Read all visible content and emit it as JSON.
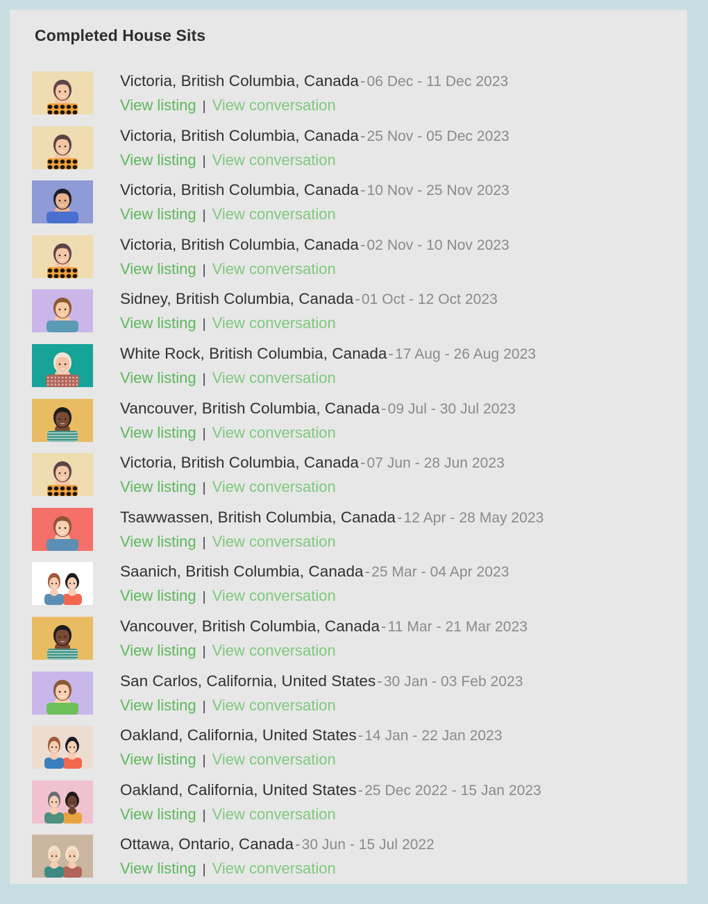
{
  "page": {
    "title": "Completed House Sits",
    "panel_bg": "#e7e7e7",
    "outer_bg": "#c8dde2",
    "link_listing_color": "#5cb85c",
    "link_conversation_color": "#7ec97e",
    "date_color": "#8a8a8a"
  },
  "labels": {
    "view_listing": "View listing",
    "view_conversation": "View conversation",
    "separator": "|",
    "dash": "-"
  },
  "sits": [
    {
      "location": "Victoria, British Columbia, Canada",
      "dates": "06 Dec - 11 Dec 2023",
      "avatar": {
        "name": "avatar-woman-leopard-top",
        "bg": "#efdcb0",
        "type": "single",
        "hair": "#5a4449",
        "skin": "#f5c6a5",
        "shirt": "#f0a23c",
        "pattern": "spots"
      }
    },
    {
      "location": "Victoria, British Columbia, Canada",
      "dates": "25 Nov - 05 Dec 2023",
      "avatar": {
        "name": "avatar-woman-leopard-top",
        "bg": "#efdcb0",
        "type": "single",
        "hair": "#5a4449",
        "skin": "#f5c6a5",
        "shirt": "#f0a23c",
        "pattern": "spots"
      }
    },
    {
      "location": "Victoria, British Columbia, Canada",
      "dates": "10 Nov - 25 Nov 2023",
      "avatar": {
        "name": "avatar-woman-dark-hair-blue",
        "bg": "#8e9bd6",
        "type": "single",
        "hair": "#1d1d28",
        "skin": "#e8b48e",
        "shirt": "#4a6fd0",
        "pattern": "plain"
      }
    },
    {
      "location": "Victoria, British Columbia, Canada",
      "dates": "02 Nov - 10 Nov 2023",
      "avatar": {
        "name": "avatar-woman-leopard-top",
        "bg": "#efdcb0",
        "type": "single",
        "hair": "#5a4449",
        "skin": "#f5c6a5",
        "shirt": "#f0a23c",
        "pattern": "spots"
      }
    },
    {
      "location": "Sidney, British Columbia, Canada",
      "dates": "01 Oct - 12 Oct 2023",
      "avatar": {
        "name": "avatar-man-brown-hair-purple",
        "bg": "#cbb6ea",
        "type": "single",
        "hair": "#8a5a33",
        "skin": "#f6c9a6",
        "shirt": "#5b9bb5",
        "pattern": "plain"
      }
    },
    {
      "location": "White Rock, British Columbia, Canada",
      "dates": "17 Aug - 26 Aug 2023",
      "avatar": {
        "name": "avatar-woman-white-hair-teal",
        "bg": "#17a398",
        "type": "single",
        "hair": "#f0e4d4",
        "skin": "#f3c4a7",
        "shirt": "#b0645a",
        "pattern": "knit"
      }
    },
    {
      "location": "Vancouver, British Columbia, Canada",
      "dates": "09 Jul - 30 Jul 2023",
      "avatar": {
        "name": "avatar-woman-bun-gold",
        "bg": "#e9bc63",
        "type": "single",
        "hair": "#1c1c1c",
        "skin": "#7a4a33",
        "shirt": "#3f9184",
        "pattern": "stripes"
      }
    },
    {
      "location": "Victoria, British Columbia, Canada",
      "dates": "07 Jun - 28 Jun 2023",
      "avatar": {
        "name": "avatar-woman-leopard-top",
        "bg": "#efdcb0",
        "type": "single",
        "hair": "#5a4449",
        "skin": "#f5c6a5",
        "shirt": "#f0a23c",
        "pattern": "spots"
      }
    },
    {
      "location": "Tsawwassen, British Columbia, Canada",
      "dates": "12 Apr - 28 May 2023",
      "avatar": {
        "name": "avatar-woman-curly-coral",
        "bg": "#f47068",
        "type": "single",
        "hair": "#8e5336",
        "skin": "#f7cfb2",
        "shirt": "#5b8fb5",
        "pattern": "plain"
      }
    },
    {
      "location": "Saanich, British Columbia, Canada",
      "dates": "25 Mar - 04 Apr 2023",
      "avatar": {
        "name": "avatar-couple-white-bg",
        "bg": "#ffffff",
        "type": "couple",
        "hair": "#a05a38",
        "hair2": "#1b1b24",
        "skin": "#f7cdb4",
        "shirt": "#5b8fb5",
        "shirt2": "#f2674f"
      }
    },
    {
      "location": "Vancouver, British Columbia, Canada",
      "dates": "11 Mar - 21 Mar 2023",
      "avatar": {
        "name": "avatar-woman-bun-gold",
        "bg": "#e9bc63",
        "type": "single",
        "hair": "#1c1c1c",
        "skin": "#7a4a33",
        "shirt": "#3f9184",
        "pattern": "stripes"
      }
    },
    {
      "location": "San Carlos, California, United States",
      "dates": "30 Jan - 03 Feb 2023",
      "avatar": {
        "name": "avatar-woman-curly-lavender",
        "bg": "#c9b6ea",
        "type": "single",
        "hair": "#8b5a36",
        "skin": "#f7cfb2",
        "shirt": "#6cc05a",
        "pattern": "plain"
      }
    },
    {
      "location": "Oakland, California, United States",
      "dates": "14 Jan - 22 Jan 2023",
      "avatar": {
        "name": "avatar-couple-beige-bg",
        "bg": "#eddcd0",
        "type": "couple",
        "hair": "#a05a38",
        "hair2": "#1b1b24",
        "skin": "#f7cdb4",
        "shirt": "#3a7fc0",
        "shirt2": "#f2674f"
      }
    },
    {
      "location": "Oakland, California, United States",
      "dates": "25 Dec 2022 - 15 Jan 2023",
      "avatar": {
        "name": "avatar-couple-pink-bg",
        "bg": "#f0c2cf",
        "type": "couple",
        "hair": "#6b6b72",
        "hair2": "#1b1b18",
        "skin": "#f7cdb4",
        "skin2": "#6d4330",
        "shirt": "#4e9180",
        "shirt2": "#e8a33d"
      }
    },
    {
      "location": "Ottawa, Ontario, Canada",
      "dates": "30 Jun - 15 Jul 2022",
      "avatar": {
        "name": "avatar-couple-tan-bg",
        "bg": "#c9b6a0",
        "type": "couple",
        "hair": "#efe2cd",
        "hair2": "#f0e2cb",
        "skin": "#f4cdb3",
        "shirt": "#3d8a82",
        "shirt2": "#b0645a"
      }
    }
  ]
}
